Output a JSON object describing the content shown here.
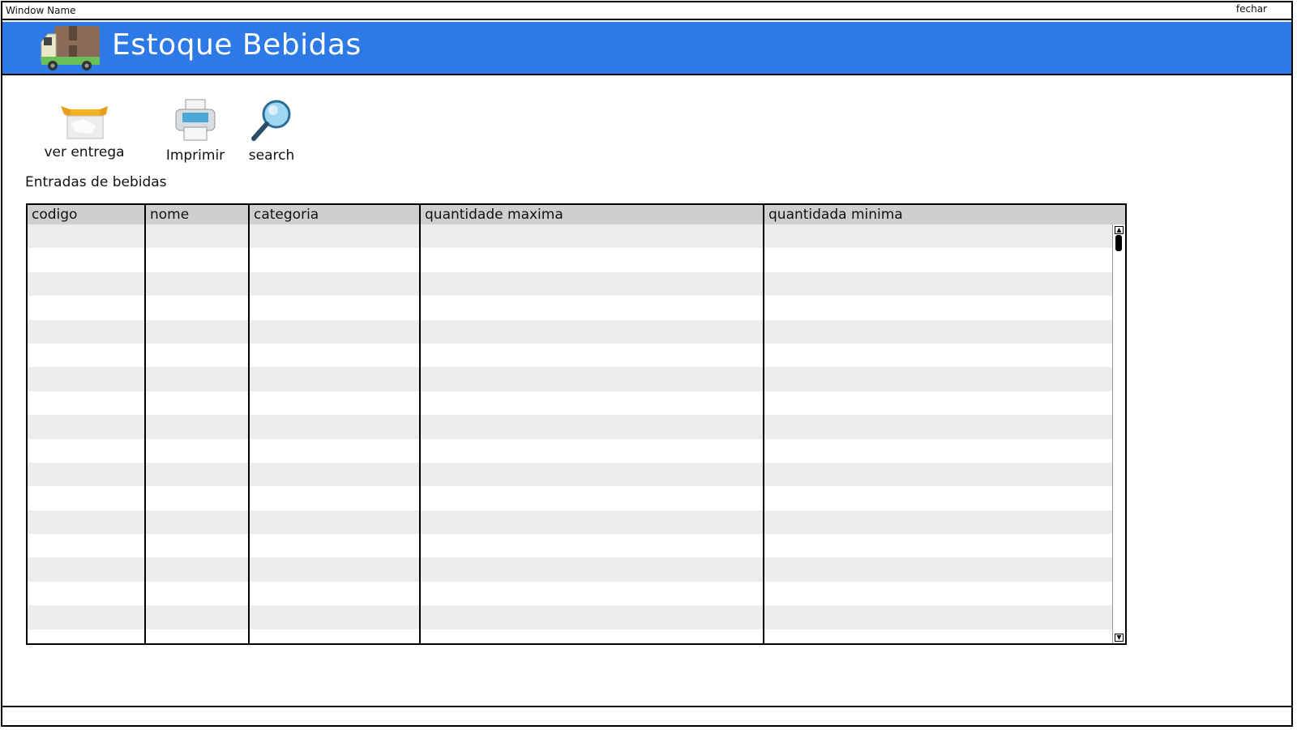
{
  "window": {
    "name": "Window Name",
    "close_label": "fechar"
  },
  "header": {
    "title": "Estoque Bebidas",
    "logo_icon": "delivery-truck-icon",
    "bg_color": "#2d79e6"
  },
  "toolbar": [
    {
      "label": "ver entrega",
      "icon": "open-box-icon"
    },
    {
      "label": "Imprimir",
      "icon": "printer-icon"
    },
    {
      "label": "search",
      "icon": "magnifier-icon"
    }
  ],
  "section_title": "Entradas de bebidas",
  "table": {
    "columns": [
      "codigo",
      "nome",
      "categoria",
      "quantidade maxima",
      "quantidada minima"
    ],
    "row_count": 18,
    "rows": []
  }
}
